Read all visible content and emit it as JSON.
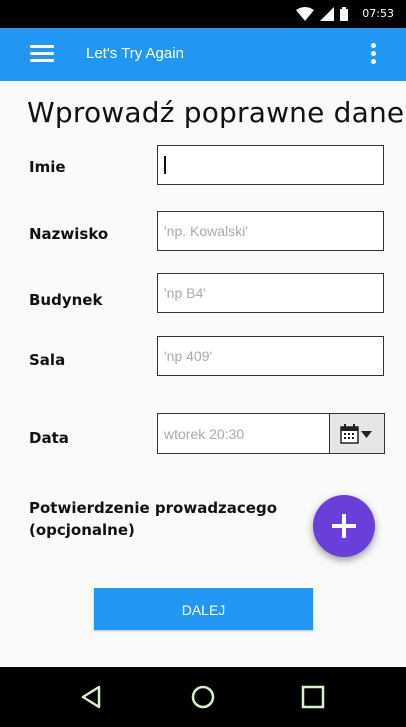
{
  "status_bar": {
    "time": "07:53",
    "icons": [
      "wifi-icon",
      "signal-icon",
      "battery-icon"
    ]
  },
  "app_bar": {
    "title": "Let's Try Again",
    "menu_icon": "hamburger-menu-icon",
    "overflow_icon": "more-vert-icon"
  },
  "form": {
    "heading": "Wprowadź poprawne dane",
    "fields": [
      {
        "label": "Imie",
        "placeholder": "",
        "value": ""
      },
      {
        "label": "Nazwisko",
        "placeholder": "'np. Kowalski'",
        "value": ""
      },
      {
        "label": "Budynek",
        "placeholder": "'np B4'",
        "value": ""
      },
      {
        "label": "Sala",
        "placeholder": "'np 409'",
        "value": ""
      }
    ],
    "date": {
      "label": "Data",
      "placeholder": "wtorek 20:30",
      "picker_icon": "calendar-dropdown-icon"
    },
    "confirmation": {
      "line1": "Potwierdzenie prowadzacego",
      "line2": "(opcjonalne)",
      "add_icon": "plus-icon"
    },
    "submit_label": "DALEJ"
  },
  "nav_bar": {
    "back_icon": "back-triangle-icon",
    "home_icon": "home-circle-icon",
    "recents_icon": "recents-square-icon"
  },
  "colors": {
    "primary": "#2196f3",
    "fab": "#6a3fd9",
    "background": "#fafafa"
  }
}
